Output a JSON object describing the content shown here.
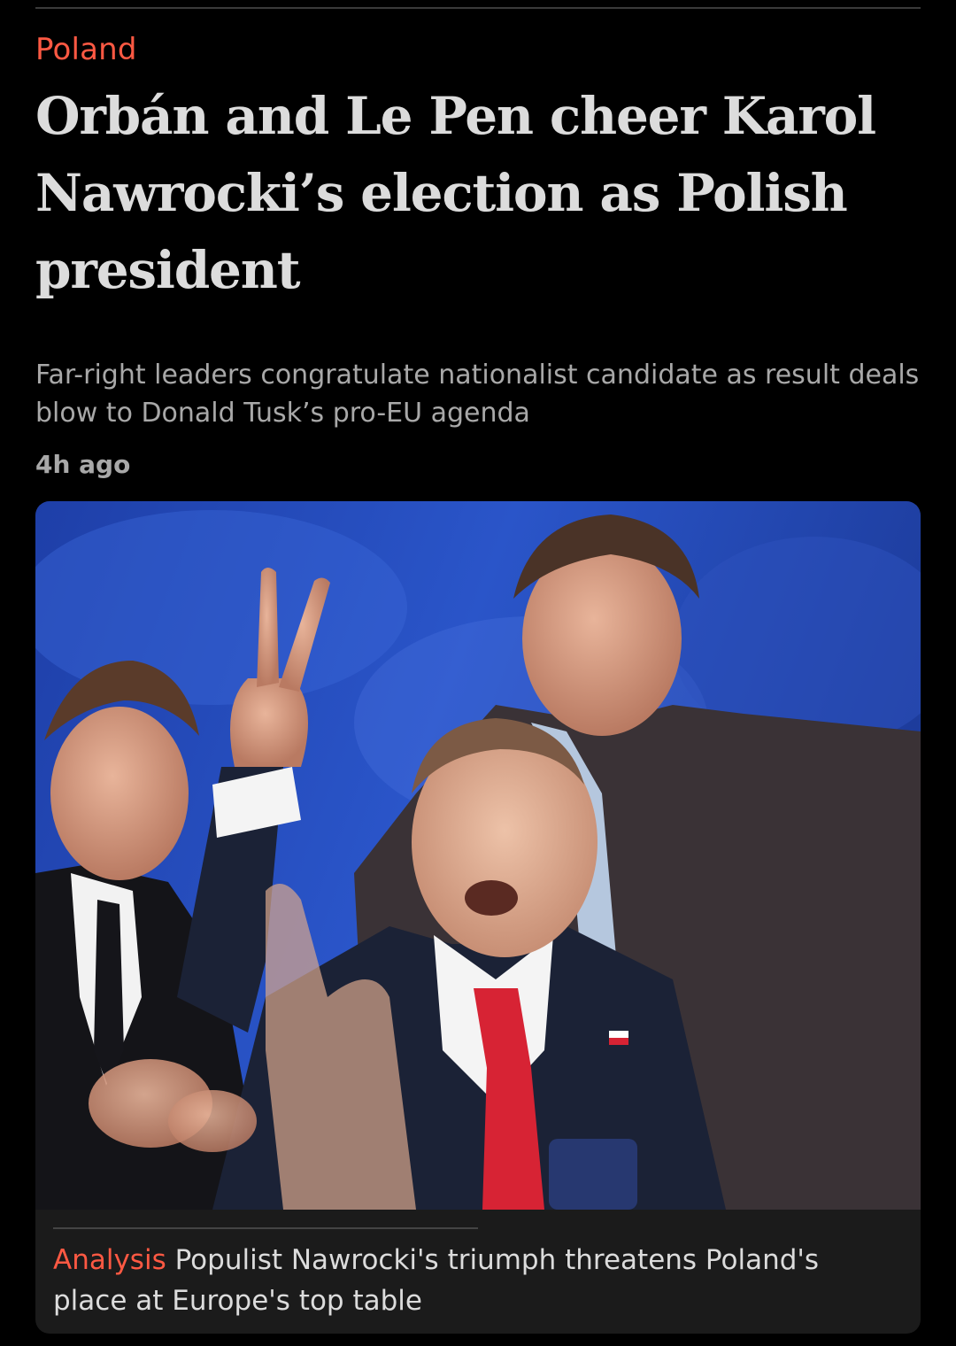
{
  "article": {
    "kicker": "Poland",
    "headline": "Orbán and Le Pen cheer Karol Nawrocki’s election as Polish president",
    "standfirst": "Far-right leaders congratulate nationalist candidate as result deals blow to Donald Tusk’s pro-EU agenda",
    "timestamp": "4h ago"
  },
  "related": {
    "kicker": "Analysis",
    "title": "Populist Nawrocki's triumph threatens Poland's place at Europe's top table"
  },
  "colors": {
    "background": "#000000",
    "kicker": "#ff5943",
    "headline": "#dcdcdc",
    "secondary_text": "#a8a8a8",
    "card": "#1b1b1b"
  }
}
